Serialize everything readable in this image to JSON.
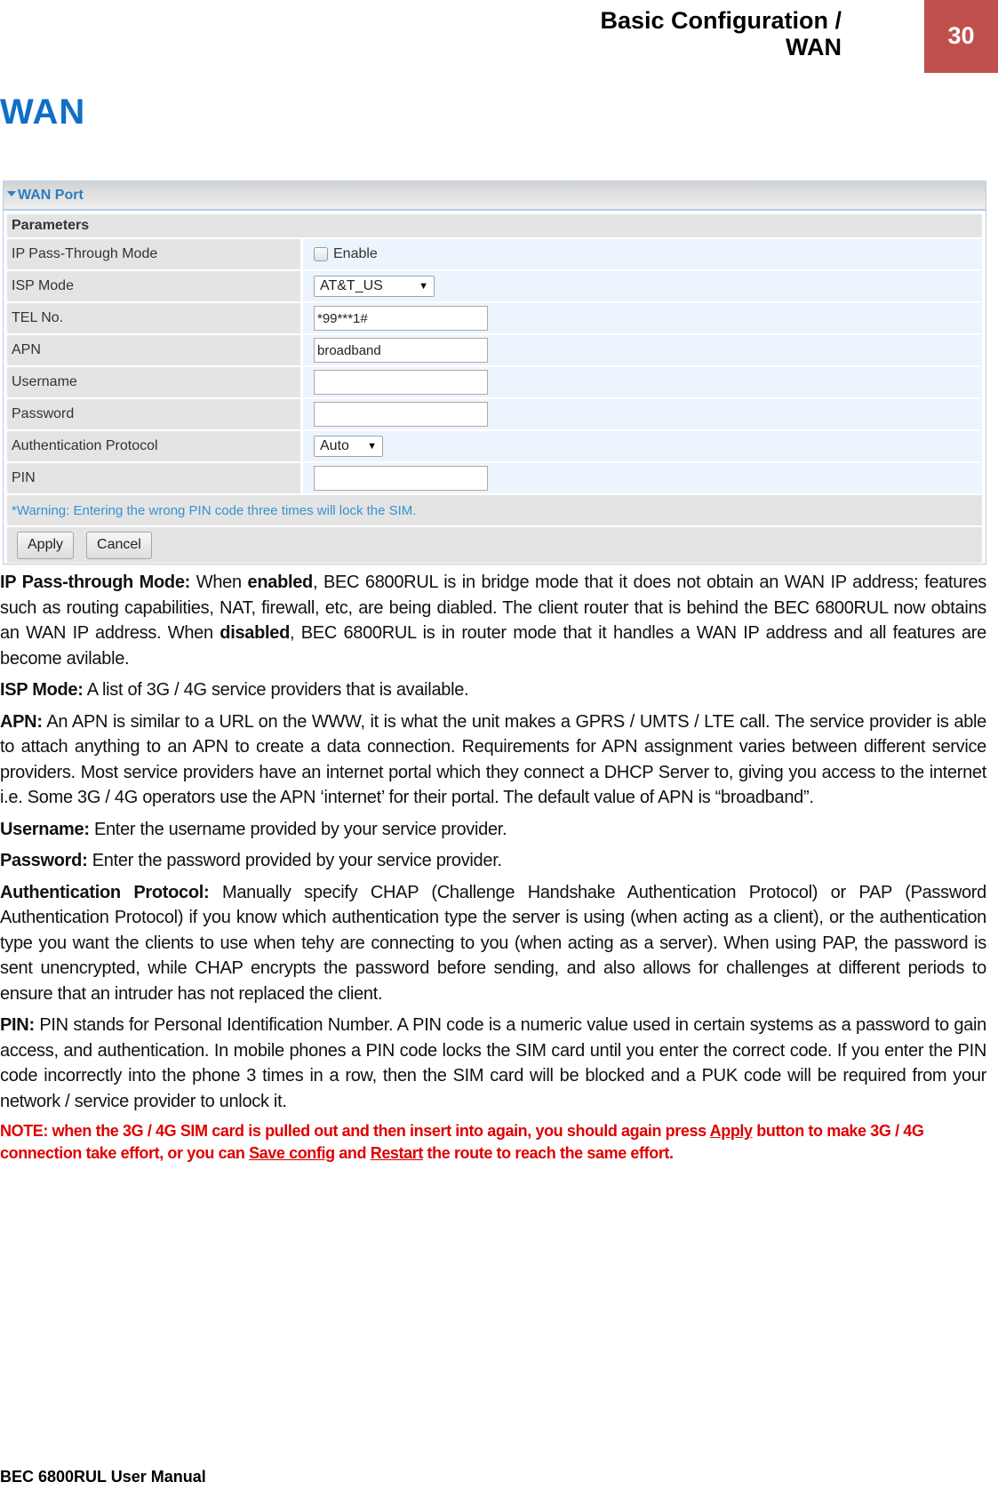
{
  "header": {
    "section_line1": "Basic Configuration /",
    "section_line2": "WAN",
    "page_number": "30",
    "page_badge_color": "#c0504d"
  },
  "page_title": "WAN",
  "panel": {
    "title": "WAN Port",
    "collapse_icon": "triangle-down-icon",
    "section_label": "Parameters",
    "rows": [
      {
        "label": "IP Pass-Through Mode",
        "type": "checkbox",
        "checked": false,
        "option_label": "Enable"
      },
      {
        "label": "ISP Mode",
        "type": "select",
        "value": "AT&T_US"
      },
      {
        "label": "TEL No.",
        "type": "text",
        "value": "*99***1#"
      },
      {
        "label": "APN",
        "type": "text",
        "value": "broadband"
      },
      {
        "label": "Username",
        "type": "text",
        "value": ""
      },
      {
        "label": "Password",
        "type": "password",
        "value": ""
      },
      {
        "label": "Authentication Protocol",
        "type": "select",
        "value": "Auto"
      },
      {
        "label": "PIN",
        "type": "text",
        "value": ""
      }
    ],
    "warning": "*Warning: Entering the wrong PIN code three times will lock the SIM.",
    "apply_label": "Apply",
    "cancel_label": "Cancel"
  },
  "descriptions": {
    "ip_pass": {
      "term": "IP Pass-through Mode:",
      "t1": " When ",
      "b1": "enabled",
      "t2": ", BEC 6800RUL is in bridge mode that it does not obtain an WAN IP address; features such as routing capabilities, NAT, firewall, etc, are being diabled. The client router that is behind the BEC 6800RUL now obtains an WAN IP address. When ",
      "b2": "disabled",
      "t3": ", BEC 6800RUL is in router mode that it handles a WAN IP address and all features are become avilable."
    },
    "isp_mode": {
      "term": "ISP Mode:",
      "text": " A list of 3G / 4G service providers that is available."
    },
    "apn": {
      "term": "APN:",
      "text": " An APN is similar to a URL on the WWW, it is what the unit makes a GPRS / UMTS / LTE call. The service provider is able to attach anything to an APN to create a data connection. Requirements for APN assignment varies between different service providers. Most service providers have an internet portal which they connect a DHCP Server to, giving you access to the internet i.e. Some 3G / 4G operators use the APN ‘internet’ for their portal. The default value of APN is “broadband”."
    },
    "username": {
      "term": "Username:",
      "text": " Enter the username provided by your service provider."
    },
    "password": {
      "term": "Password:",
      "text": " Enter the password provided by your service provider."
    },
    "auth": {
      "term": "Authentication Protocol:",
      "text": " Manually specify CHAP (Challenge Handshake Authentication Protocol) or PAP (Password Authentication Protocol) if you know which authentication type the server is using (when acting as a client), or the authentication type you want the clients to use when tehy are connecting to you (when acting as a server). When using PAP, the password is sent unencrypted, while CHAP encrypts the password before sending, and also allows for challenges at different periods to ensure that an intruder has not replaced the client."
    },
    "pin": {
      "term": "PIN:",
      "text": " PIN stands for Personal Identification Number. A PIN code is a numeric value used in certain systems as a password to gain access, and authentication. In mobile phones a PIN code locks the SIM card until you enter the correct code. If you enter the PIN code incorrectly into the phone 3 times in a row, then the SIM card will be blocked and a PUK code will be required from your network / service provider to unlock it."
    },
    "note": {
      "t1": "NOTE: when the 3G / 4G SIM card is pulled out and then insert into again, you should again press ",
      "link1": "Apply",
      "t2": " button to make 3G / 4G connection take effort, or you can ",
      "link2": "Save config",
      "t3": " and ",
      "link3": "Restart",
      "t4": " the route to reach the same effort.",
      "color": "#e00000"
    }
  },
  "footer": "BEC 6800RUL User Manual"
}
